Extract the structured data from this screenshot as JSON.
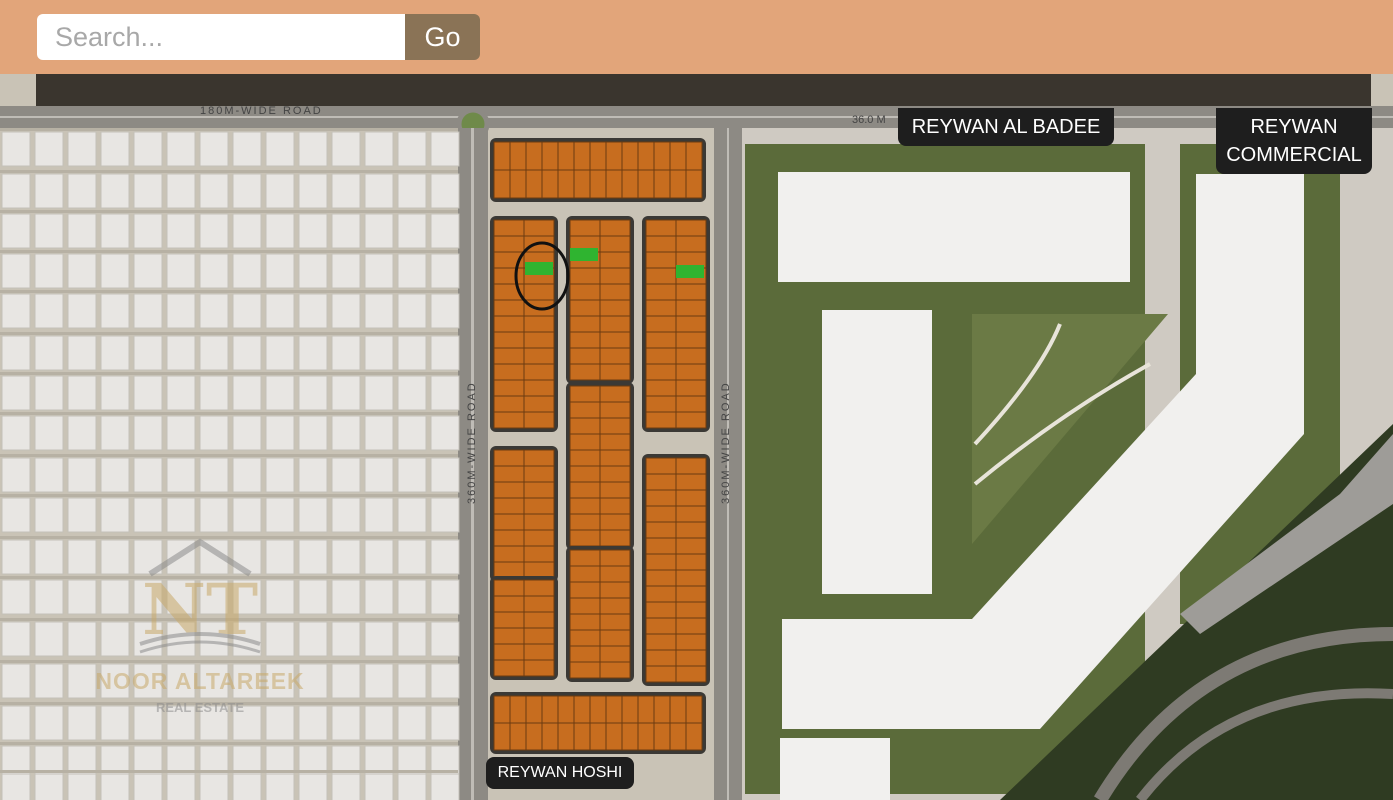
{
  "search": {
    "placeholder": "Search...",
    "value": "",
    "button_label": "Go"
  },
  "map": {
    "labels": {
      "badee": "REYWAN AL BADEE",
      "commercial": "REYWAN\nCOMMERCIAL",
      "hoshi": "REYWAN HOSHI"
    },
    "roads": {
      "top_left": "180M-WIDE ROAD",
      "top_right": "36.0 M",
      "vertical_left": "360M-WIDE ROAD",
      "vertical_right": "360M-WIDE ROAD"
    },
    "highlight": {
      "plot_color": "#2fb430",
      "circle_color": "#111111",
      "selected_plots": 3
    },
    "watermark": {
      "brand": "NOOR ALTAREEK",
      "subtitle": "REAL ESTATE"
    }
  },
  "colors": {
    "topbar": "#e2a57a",
    "go_button": "#8a7356",
    "plot": "#c76d1f",
    "plot_border": "#6b3a10",
    "villa": "#e8e6e3",
    "greenery": "#5b6b3a",
    "label_bg": "#1e1e1e"
  }
}
